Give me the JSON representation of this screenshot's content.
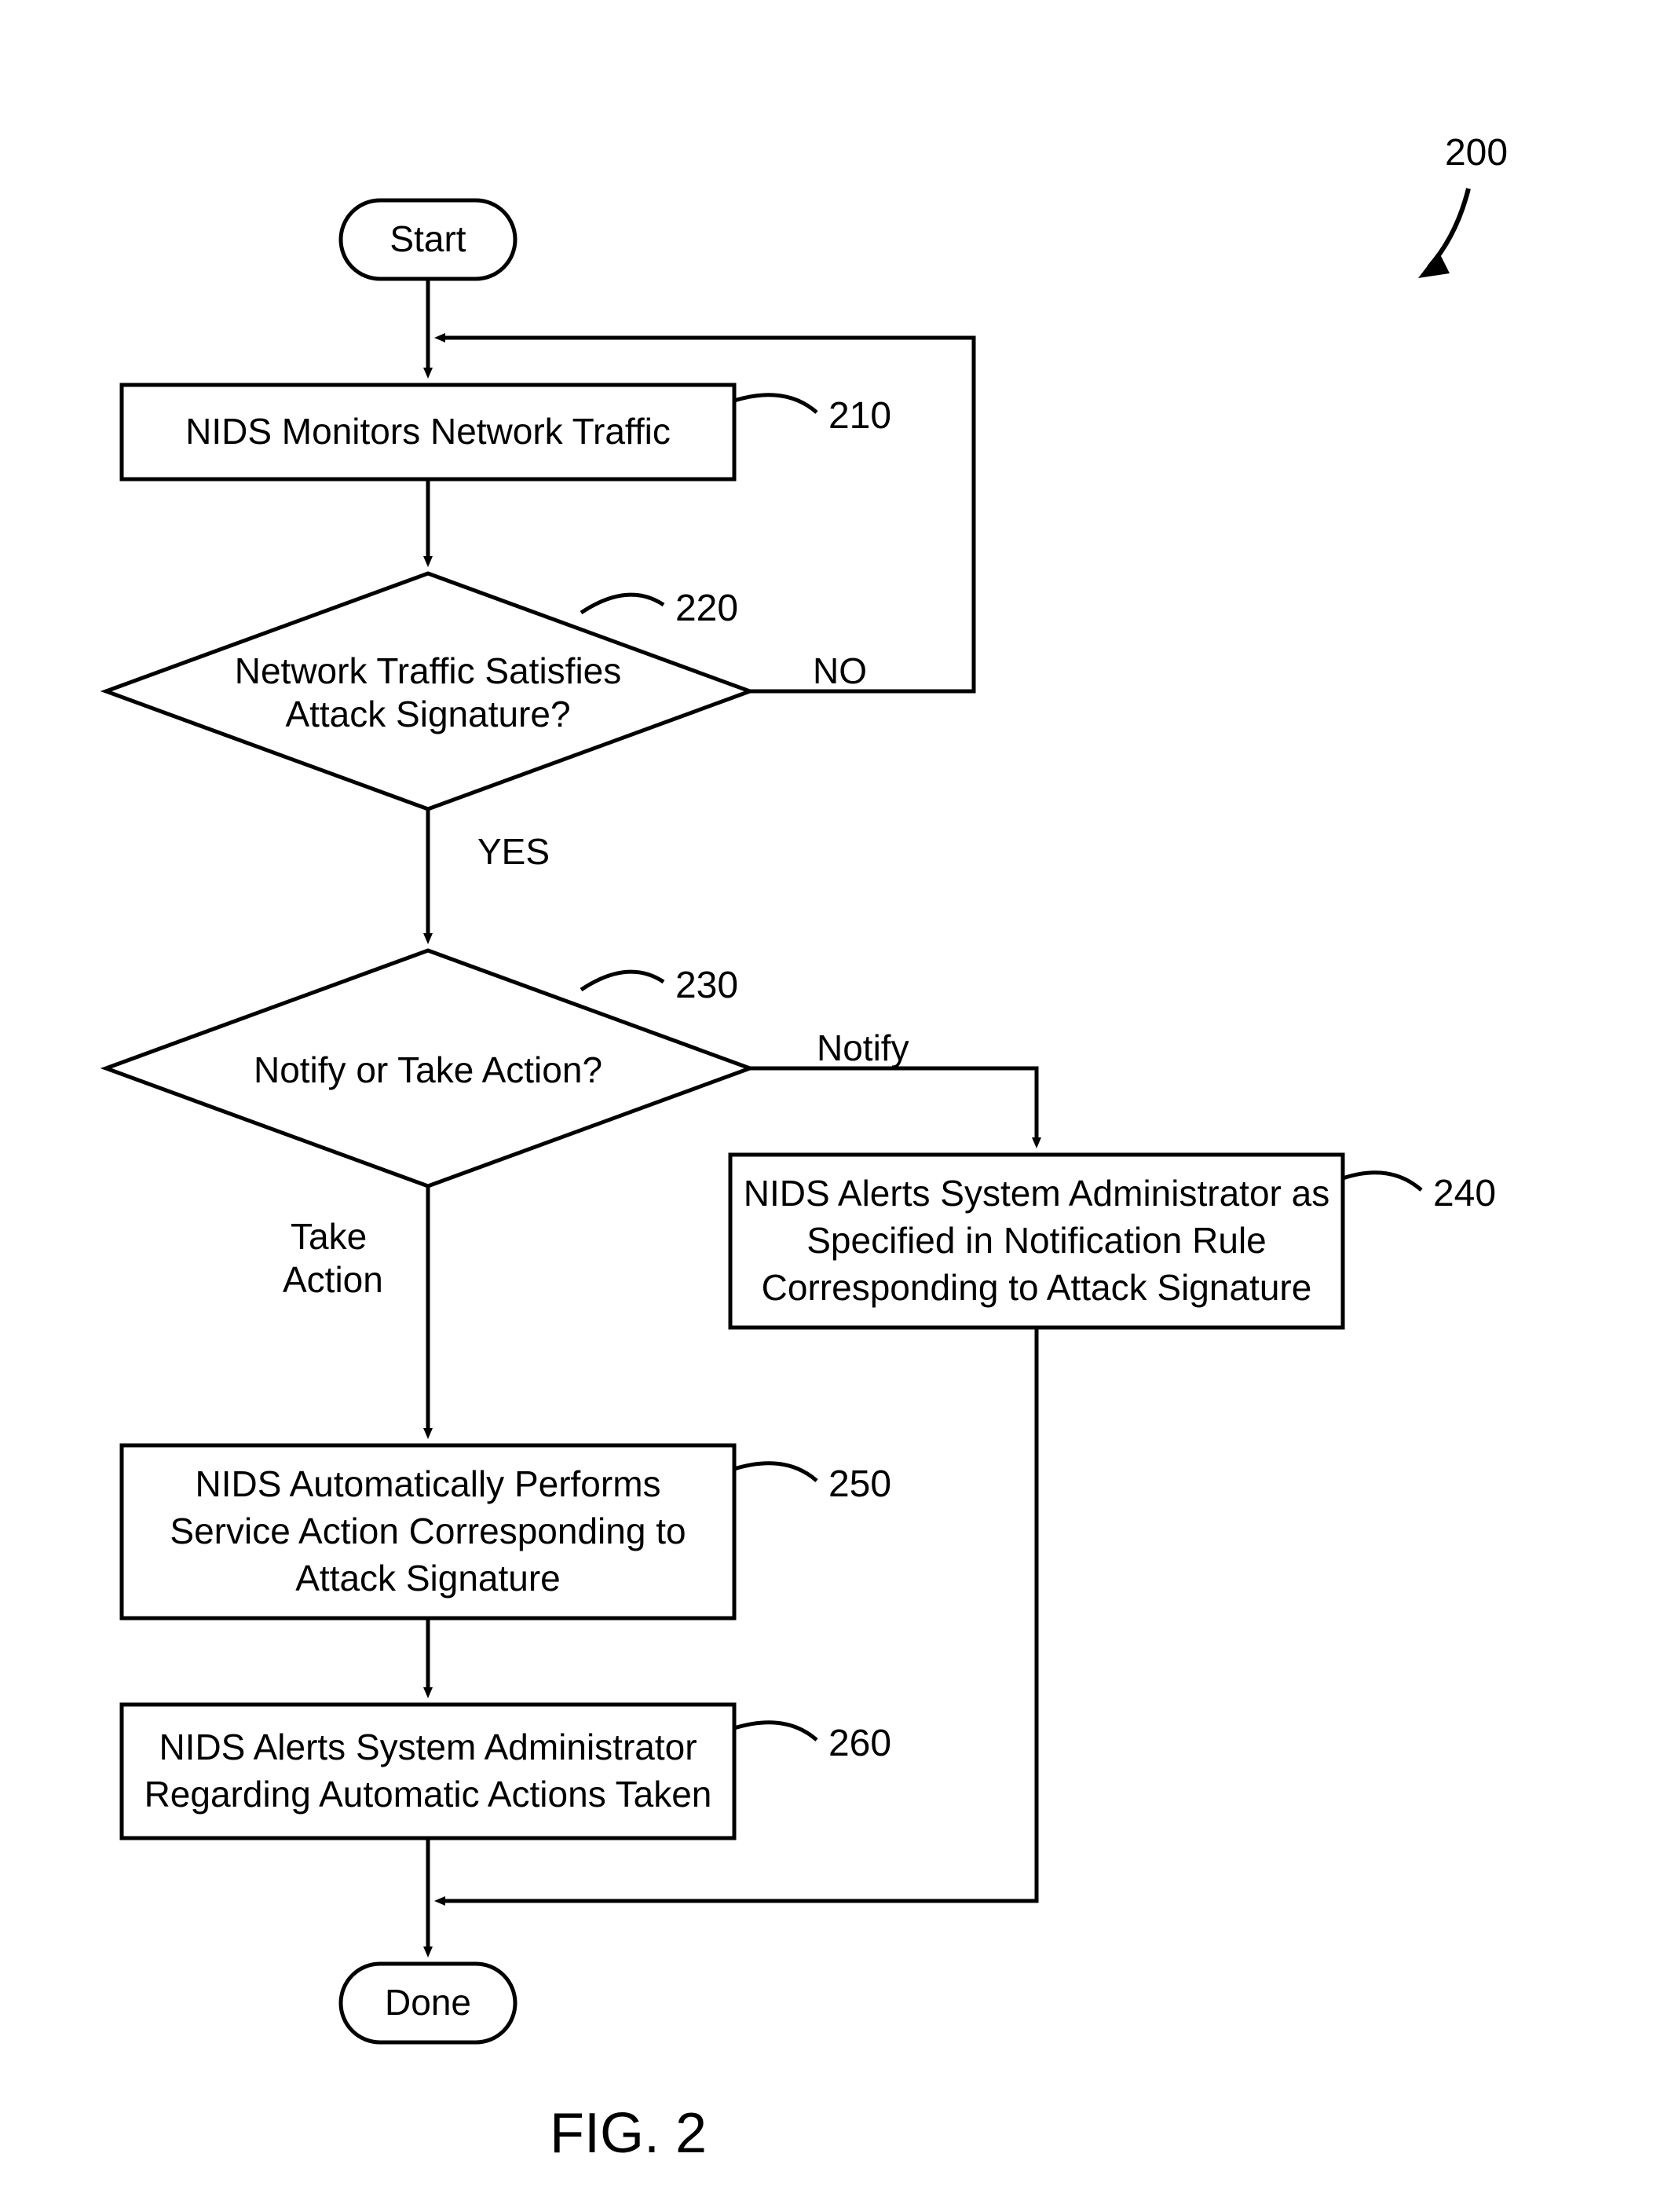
{
  "figure": {
    "number_label": "200",
    "caption": "FIG. 2"
  },
  "terminals": {
    "start": "Start",
    "done": "Done"
  },
  "steps": {
    "s210": {
      "ref": "210",
      "text": "NIDS Monitors Network Traffic"
    },
    "s220": {
      "ref": "220",
      "line1": "Network Traffic Satisfies",
      "line2": "Attack Signature?"
    },
    "s230": {
      "ref": "230",
      "text": "Notify or Take Action?"
    },
    "s240": {
      "ref": "240",
      "line1": "NIDS Alerts System Administrator as",
      "line2": "Specified in Notification Rule",
      "line3": "Corresponding to Attack Signature"
    },
    "s250": {
      "ref": "250",
      "line1": "NIDS Automatically Performs",
      "line2": "Service Action Corresponding to",
      "line3": "Attack Signature"
    },
    "s260": {
      "ref": "260",
      "line1": "NIDS Alerts System Administrator",
      "line2": "Regarding Automatic Actions Taken"
    }
  },
  "branches": {
    "no": "NO",
    "yes": "YES",
    "notify": "Notify",
    "take_action_l1": "Take",
    "take_action_l2": "Action"
  }
}
